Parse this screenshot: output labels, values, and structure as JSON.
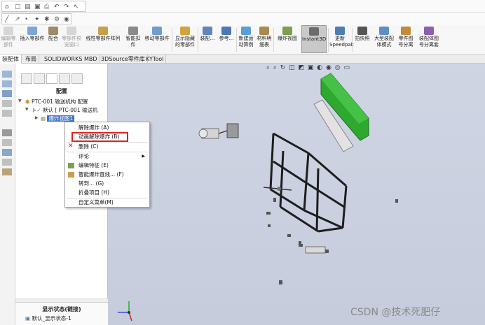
{
  "ribbon": {
    "items": [
      {
        "label": "编辑零\n部件",
        "disabled": true
      },
      {
        "label": "插入零部件",
        "disabled": false
      },
      {
        "label": "配合",
        "disabled": false
      },
      {
        "label": "零部件预\n览窗口",
        "disabled": true
      },
      {
        "label": "线性零部件阵列",
        "disabled": false
      },
      {
        "label": "智能扣\n件",
        "disabled": false
      },
      {
        "label": "移动零部件",
        "disabled": false
      },
      {
        "label": "显示隐藏\n的零部件",
        "disabled": false
      },
      {
        "label": "装配...",
        "disabled": false
      },
      {
        "label": "参考...",
        "disabled": false
      },
      {
        "label": "新建运\n动算例",
        "disabled": false
      },
      {
        "label": "材料明\n细表",
        "disabled": false
      },
      {
        "label": "爆炸视图",
        "disabled": false
      },
      {
        "label": "Instant3D",
        "disabled": false
      },
      {
        "label": "更新\nSpeedpak",
        "disabled": false
      },
      {
        "label": "拍快照",
        "disabled": false
      },
      {
        "label": "大型装配\n体模式",
        "disabled": false
      },
      {
        "label": "零件图\n号分离",
        "disabled": false
      },
      {
        "label": "装配体图\n号分离套",
        "disabled": false
      }
    ]
  },
  "tabs": [
    "装配体",
    "布局",
    "SOLIDWORKS MBD",
    "3DSource零件库",
    "KYTool"
  ],
  "panel": {
    "title": "配置",
    "tree": {
      "root": "PTC-001 输送机构 配置",
      "config": "默认 [ PTC-001 输送机",
      "explode": "爆炸视图1"
    },
    "footer_title": "显示状态(链接)",
    "footer_value": "默认_显示状态-1"
  },
  "context_menu": {
    "items": [
      {
        "label": "解除爆炸 (A)",
        "icon": "none"
      },
      {
        "label": "动画解除爆炸 (B)",
        "icon": "none"
      },
      {
        "label": "删除 (C)",
        "icon": "delete-icon"
      },
      {
        "label": "评论",
        "icon": "none",
        "submenu": true
      },
      {
        "label": "编辑特征 (E)",
        "icon": "edit-feature-icon"
      },
      {
        "label": "智能爆炸直线... (F)",
        "icon": "smart-line-icon"
      },
      {
        "label": "转到... (G)",
        "icon": "none"
      },
      {
        "label": "折叠项目 (H)",
        "icon": "none"
      },
      {
        "label": "自定义菜单(M)",
        "icon": "none"
      }
    ]
  },
  "watermark": "CSDN @技术死肥仔",
  "colors": {
    "highlight": "#3f73c4",
    "red_box": "#e02020",
    "green_part": "#2ea82e",
    "viewport": "#c9cfdf"
  }
}
